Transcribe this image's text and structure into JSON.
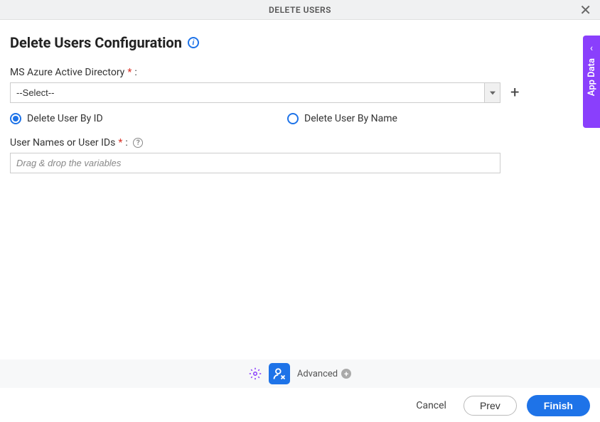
{
  "header": {
    "title": "DELETE USERS"
  },
  "page": {
    "title": "Delete Users Configuration"
  },
  "fields": {
    "directory": {
      "label": "MS Azure Active Directory",
      "value": "--Select--"
    },
    "radio": {
      "by_id": "Delete User By ID",
      "by_name": "Delete User By Name",
      "selected": "by_id"
    },
    "user_ids": {
      "label": "User Names or User IDs",
      "placeholder": "Drag & drop the variables"
    }
  },
  "sidebar": {
    "label": "App Data"
  },
  "toolbar": {
    "advanced": "Advanced"
  },
  "footer": {
    "cancel": "Cancel",
    "prev": "Prev",
    "finish": "Finish"
  }
}
